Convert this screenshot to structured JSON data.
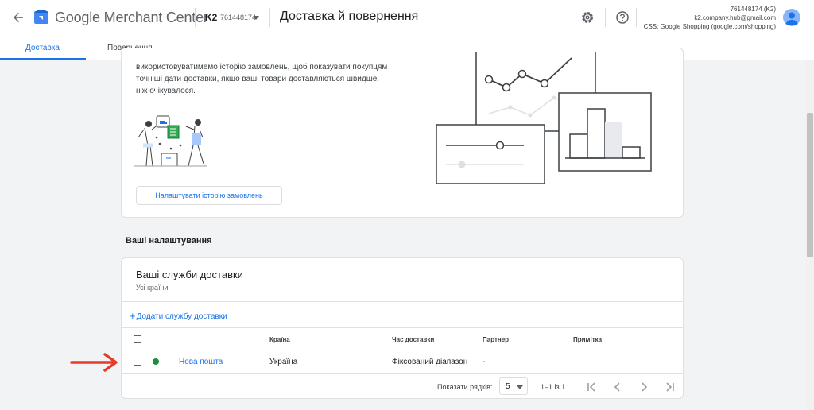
{
  "header": {
    "brand": "Google Merchant Center",
    "account_short": "K2",
    "account_id": "761448174",
    "page_title": "Доставка й повернення",
    "account_info": {
      "line1": "761448174 (K2)",
      "line2": "k2.company.hub@gmail.com",
      "line3": "CSS: Google Shopping (google.com/shopping)"
    },
    "icons": [
      "back-arrow-icon",
      "merchant-center-logo",
      "dropdown-caret-icon",
      "settings-gear-icon",
      "help-icon",
      "account-avatar"
    ]
  },
  "tabs": [
    {
      "label": "Доставка",
      "active": true
    },
    {
      "label": "Повернення",
      "active": false
    }
  ],
  "order_history_card": {
    "description": "використовуватимемо історію замовлень, щоб показувати покупцям точніші дати доставки, якщо ваші товари доставляються швидше, ніж очікувалося.",
    "button_label": "Налаштувати історію замовлень"
  },
  "section_title": "Ваші налаштування",
  "services_card": {
    "title": "Ваші служби доставки",
    "subtitle": "Усі країни",
    "add_link": "Додати службу доставки",
    "columns": [
      "Країна",
      "Час доставки",
      "Партнер",
      "Примітка"
    ],
    "rows": [
      {
        "name": "Нова пошта",
        "status": "active",
        "country": "Україна",
        "delivery_time": "Фіксований діапазон",
        "partner": "-",
        "note": ""
      }
    ],
    "footer": {
      "rows_label": "Показати рядків:",
      "rows_value": "5",
      "range": "1–1 із 1"
    }
  },
  "colors": {
    "accent": "#1a73e8",
    "status_active": "#1e8e3e",
    "annotation_arrow": "#e8392a"
  }
}
